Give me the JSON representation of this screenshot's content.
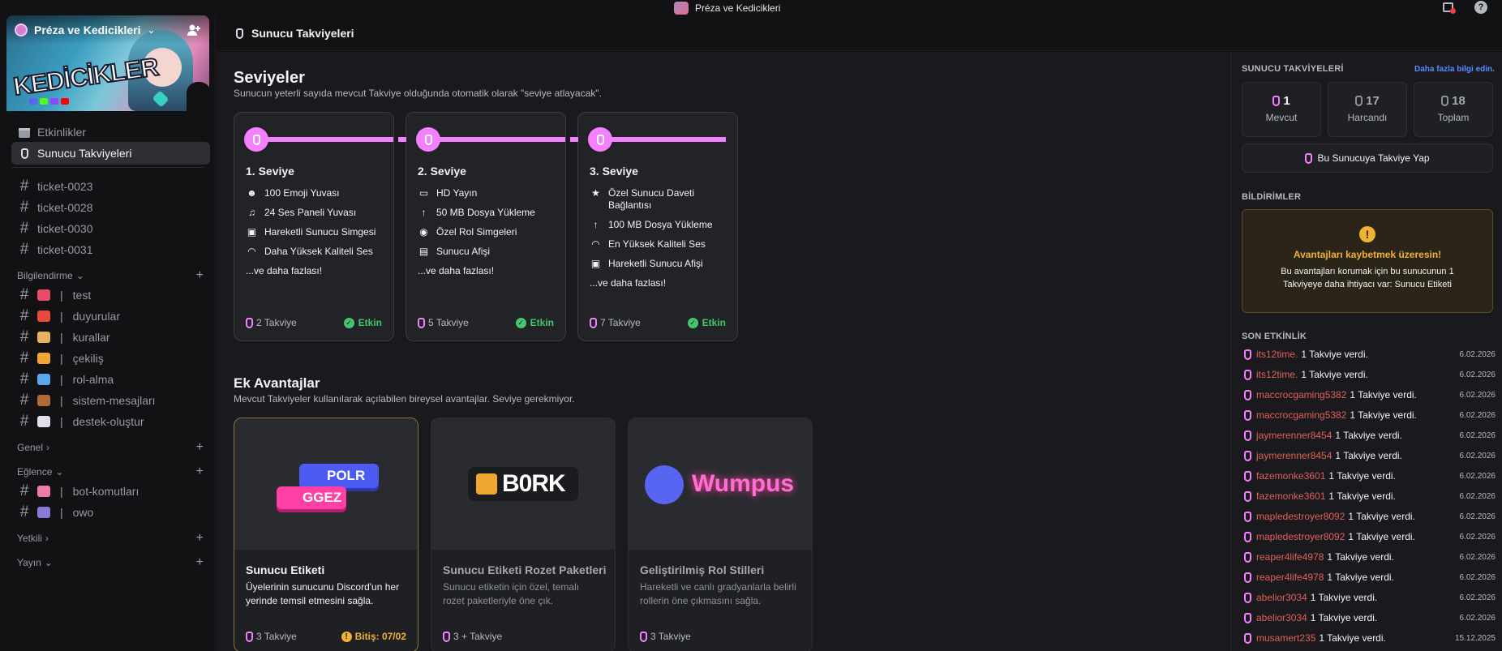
{
  "titlebar": {
    "server_name": "Préza ve Kedicikleri"
  },
  "sidebar": {
    "server_name": "Préza ve Kedicikleri",
    "banner_text": "KEDİCİKLER",
    "nav": [
      {
        "label": "Etkinlikler",
        "icon": "calendar-icon"
      },
      {
        "label": "Sunucu Takviyeleri",
        "icon": "boost-gem-icon",
        "active": true
      }
    ],
    "tickets": [
      "ticket-0023",
      "ticket-0028",
      "ticket-0030",
      "ticket-0031"
    ],
    "categories": {
      "bilgilendirme": "Bilgilendirme",
      "genel": "Genel",
      "eglence": "Eğlence",
      "yetkili": "Yetkili",
      "yayin": "Yayın"
    },
    "bilgilendirme_channels": [
      {
        "label": "test",
        "emoji_color": "#e84a6a"
      },
      {
        "label": "duyurular",
        "emoji_color": "#e84a3c"
      },
      {
        "label": "kurallar",
        "emoji_color": "#e6b35c"
      },
      {
        "label": "çekiliş",
        "emoji_color": "#f0a833"
      },
      {
        "label": "rol-alma",
        "emoji_color": "#5aa7f0"
      },
      {
        "label": "sistem-mesajları",
        "emoji_color": "#b06a3a"
      },
      {
        "label": "destek-oluştur",
        "emoji_color": "#e0e0ea"
      }
    ],
    "eglence_channels": [
      {
        "label": "bot-komutları",
        "emoji_color": "#f07aa8"
      },
      {
        "label": "owo",
        "emoji_color": "#8a7ad8"
      }
    ]
  },
  "header": {
    "title": "Sunucu Takviyeleri"
  },
  "levels": {
    "title": "Seviyeler",
    "subtitle": "Sunucun yeterli sayıda mevcut Takviye olduğunda otomatik olarak \"seviye atlayacak\".",
    "tiers": [
      {
        "name": "1. Seviye",
        "perks": [
          {
            "icon": "emoji-icon",
            "glyph": "☻",
            "text": "100 Emoji Yuvası"
          },
          {
            "icon": "soundboard-icon",
            "glyph": "♫",
            "text": "24 Ses Paneli Yuvası"
          },
          {
            "icon": "gif-icon",
            "glyph": "▣",
            "text": "Hareketli Sunucu Simgesi"
          },
          {
            "icon": "headphones-icon",
            "glyph": "◠",
            "text": "Daha Yüksek Kaliteli Ses"
          }
        ],
        "more": "...ve daha fazlası!",
        "cost": "2 Takviye",
        "status": "Etkin"
      },
      {
        "name": "2. Seviye",
        "perks": [
          {
            "icon": "hd-stream-icon",
            "glyph": "▭",
            "text": "HD Yayın"
          },
          {
            "icon": "upload-icon",
            "glyph": "↑",
            "text": "50 MB Dosya Yükleme"
          },
          {
            "icon": "role-icon",
            "glyph": "◉",
            "text": "Özel Rol Simgeleri"
          },
          {
            "icon": "banner-icon",
            "glyph": "▤",
            "text": "Sunucu Afişi"
          }
        ],
        "more": "...ve daha fazlası!",
        "cost": "5 Takviye",
        "status": "Etkin"
      },
      {
        "name": "3. Seviye",
        "perks": [
          {
            "icon": "star-icon",
            "glyph": "★",
            "text": "Özel Sunucu Daveti Bağlantısı"
          },
          {
            "icon": "upload-icon",
            "glyph": "↑",
            "text": "100 MB Dosya Yükleme"
          },
          {
            "icon": "headphones-icon",
            "glyph": "◠",
            "text": "En Yüksek Kaliteli Ses"
          },
          {
            "icon": "gif-icon",
            "glyph": "▣",
            "text": "Hareketli Sunucu Afişi"
          }
        ],
        "more": "...ve daha fazlası!",
        "cost": "7 Takviye",
        "status": "Etkin"
      }
    ]
  },
  "extra": {
    "title": "Ek Avantajlar",
    "subtitle": "Mevcut Takviyeler kullanılarak açılabilen bireysel avantajlar. Seviye gerekmiyor.",
    "perks": [
      {
        "title": "Sunucu Etiketi",
        "desc": "Üyelerinin sunucunu Discord'un her yerinde temsil etmesini sağla.",
        "cost": "3 Takviye",
        "expiry": "Bitiş: 07/02",
        "tag1": "POLR",
        "tag2": "GGEZ"
      },
      {
        "title": "Sunucu Etiketi Rozet Paketleri",
        "desc": "Sunucu etiketin için özel, temalı rozet paketleriyle öne çık.",
        "cost": "3 + Takviye",
        "art_text": "B0RK"
      },
      {
        "title": "Geliştirilmiş Rol Stilleri",
        "desc": "Hareketli ve canlı gradyanlarla belirli rollerin öne çıkmasını sağla.",
        "cost": "3 Takviye",
        "art_text": "Wumpus"
      }
    ]
  },
  "panel": {
    "boosts_label": "SUNUCU TAKVİYELERİ",
    "learn_more": "Daha fazla bilgi edin.",
    "stats": [
      {
        "value": "1",
        "label": "Mevcut"
      },
      {
        "value": "17",
        "label": "Harcandı"
      },
      {
        "value": "18",
        "label": "Toplam"
      }
    ],
    "boost_button": "Bu Sunucuya Takviye Yap",
    "notifications_label": "BİLDİRİMLER",
    "notice_title": "Avantajları kaybetmek üzeresin!",
    "notice_body": "Bu avantajları korumak için bu sunucunun 1 Takviyeye daha ihtiyacı var: Sunucu Etiketi",
    "activity_label": "SON ETKİNLİK",
    "activity": [
      {
        "user": "its12time.",
        "text": "1 Takviye verdi.",
        "date": "6.02.2026"
      },
      {
        "user": "its12time.",
        "text": "1 Takviye verdi.",
        "date": "6.02.2026"
      },
      {
        "user": "maccrocgaming5382",
        "text": "1 Takviye verdi.",
        "date": "6.02.2026"
      },
      {
        "user": "maccrocgaming5382",
        "text": "1 Takviye verdi.",
        "date": "6.02.2026"
      },
      {
        "user": "jaymerenner8454",
        "text": "1 Takviye verdi.",
        "date": "6.02.2026"
      },
      {
        "user": "jaymerenner8454",
        "text": "1 Takviye verdi.",
        "date": "6.02.2026"
      },
      {
        "user": "fazemonke3601",
        "text": "1 Takviye verdi.",
        "date": "6.02.2026"
      },
      {
        "user": "fazemonke3601",
        "text": "1 Takviye verdi.",
        "date": "6.02.2026"
      },
      {
        "user": "mapledestroyer8092",
        "text": "1 Takviye verdi.",
        "date": "6.02.2026"
      },
      {
        "user": "mapledestroyer8092",
        "text": "1 Takviye verdi.",
        "date": "6.02.2026"
      },
      {
        "user": "reaper4life4978",
        "text": "1 Takviye verdi.",
        "date": "6.02.2026"
      },
      {
        "user": "reaper4life4978",
        "text": "1 Takviye verdi.",
        "date": "6.02.2026"
      },
      {
        "user": "abelior3034",
        "text": "1 Takviye verdi.",
        "date": "6.02.2026"
      },
      {
        "user": "abelior3034",
        "text": "1 Takviye verdi.",
        "date": "6.02.2026"
      },
      {
        "user": "musamert235",
        "text": "1 Takviye verdi.",
        "date": "15.12.2025"
      }
    ]
  },
  "colors": {
    "boost_pink": "#f47fff",
    "active_green": "#46c46e",
    "warning": "#f0b232",
    "username_red": "#e0605a"
  }
}
